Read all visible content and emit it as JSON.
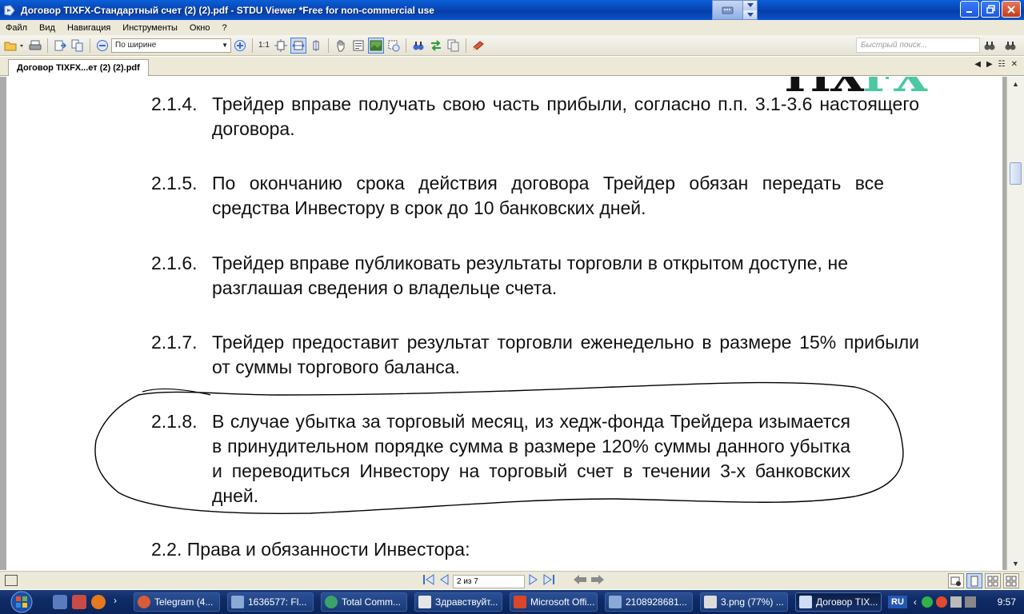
{
  "window": {
    "title": "Договор TIXFX-Стандартный счет (2) (2).pdf - STDU Viewer *Free for non-commercial use"
  },
  "menu": [
    "Файл",
    "Вид",
    "Навигация",
    "Инструменты",
    "Окно",
    "?"
  ],
  "toolbar": {
    "zoom_mode": "По ширине",
    "actual_size_label": "1:1",
    "search_placeholder": "Быстрый поиск..."
  },
  "tab": {
    "label": "Договор TIXFX...ет (2) (2).pdf"
  },
  "document": {
    "logo_dark": "TIX",
    "logo_accent": "FX",
    "clauses": [
      {
        "num": "2.1.4.",
        "text": "Трейдер вправе получать свою часть прибыли, согласно п.п. 3.1-3.6 настоящего договора."
      },
      {
        "num": "2.1.5.",
        "text": "По окончанию срока действия договора Трейдер обязан передать все средства Инвестору в срок до 10 банковских дней."
      },
      {
        "num": "2.1.6.",
        "text": "Трейдер вправе публиковать результаты торговли в открытом доступе, не разглашая сведения о владельце счета."
      },
      {
        "num": "2.1.7.",
        "text": "Трейдер предоставит результат торговли еженедельно в размере 15% прибыли от суммы торгового баланса."
      },
      {
        "num": "2.1.8.",
        "text": "В случае убытка за торговый месяц, из хедж-фонда Трейдера изымается в принудительном порядке сумма в размере 120% суммы данного убытка и переводиться Инвестору на торговый счет в течении 3-х банковских дней."
      }
    ],
    "subsection": "2.2.  Права и обязанности Инвестора:"
  },
  "statusbar": {
    "page_indicator": "2 из 7"
  },
  "taskbar": {
    "tasks": [
      "Telegram (4...",
      "1636577: Fl...",
      "Total Comm...",
      "Здравствуйт...",
      "Microsoft Offi...",
      "2108928681...",
      "3.png (77%) ...",
      "Договор TIX..."
    ],
    "language": "RU",
    "time": "9:57"
  },
  "colors": {
    "titlebar": "#0846b5",
    "logo_accent": "#4cc7a4",
    "taskbar": "#0f2b66"
  }
}
